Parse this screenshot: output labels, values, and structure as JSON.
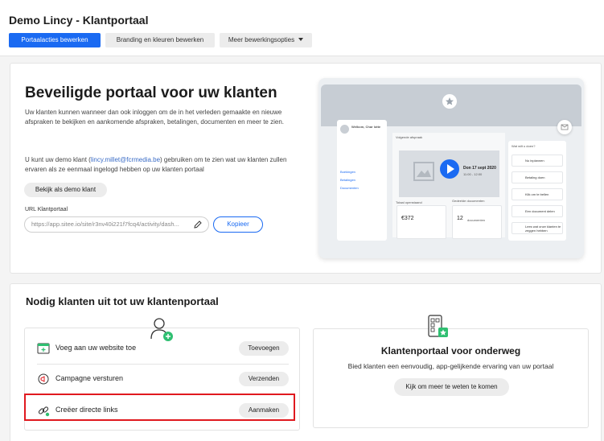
{
  "header": {
    "app_title": "Demo Lincy - Klantportaal",
    "tabs": [
      {
        "label": "Portaalacties bewerken"
      },
      {
        "label": "Branding en kleuren bewerken"
      },
      {
        "label": "Meer bewerkingsopties"
      }
    ]
  },
  "portal": {
    "title": "Beveiligde portaal voor uw klanten",
    "description": "Uw klanten kunnen wanneer dan ook inloggen om de in het verleden gemaakte en nieuwe afspraken te bekijken en aankomende afspraken, betalingen, documenten en meer te zien.",
    "demo_text_before": "U kunt uw demo klant (",
    "demo_email": "lincy.millet@fcrmedia.be",
    "demo_text_after": ") gebruiken om te zien wat uw klanten zullen ervaren als ze eenmaal ingelogd hebben op uw klanten portaal",
    "demo_button": "Bekijk als demo klant",
    "url_label": "URL Klantportaal",
    "url_value": "https://app.sitee.io/site/r3nv40i221f7fcq4/activity/dash...",
    "copy_button": "Kopieer"
  },
  "mockup": {
    "welcome": "Welkom, Char lotte",
    "upcoming": "Volgende afspraak",
    "date": "Don 17 sept 2020",
    "time": "11:00 - 12:00",
    "total_label": "Totaal openstaand",
    "total_value": "€372",
    "recent_label": "Gedeelde documenten",
    "recent_value": "12",
    "recent_unit": "documenten",
    "side_links": [
      "Boekingen",
      "Betalingen",
      "Documenten"
    ],
    "actions_title": "Wat wilt u doen?",
    "actions": [
      "Nu inplannen",
      "Betaling doen",
      "Klik om te bellen",
      "Een document delen",
      "Lees wat onze klanten te zeggen hebben"
    ]
  },
  "invite": {
    "title": "Nodig klanten uit tot uw klantenportaal",
    "rows": [
      {
        "label": "Voeg aan uw website toe",
        "button": "Toevoegen"
      },
      {
        "label": "Campagne versturen",
        "button": "Verzenden"
      },
      {
        "label": "Creëer directe links",
        "button": "Aanmaken"
      }
    ]
  },
  "education": {
    "title": "Klantenportaal voor onderweg",
    "description": "Bied klanten een eenvoudig, app-gelijkende ervaring van uw portaal",
    "button": "Kijk om meer te weten te komen"
  },
  "colors": {
    "primary": "#1a6af2",
    "highlight": "#e0191f",
    "accent_green": "#2fbf71"
  }
}
